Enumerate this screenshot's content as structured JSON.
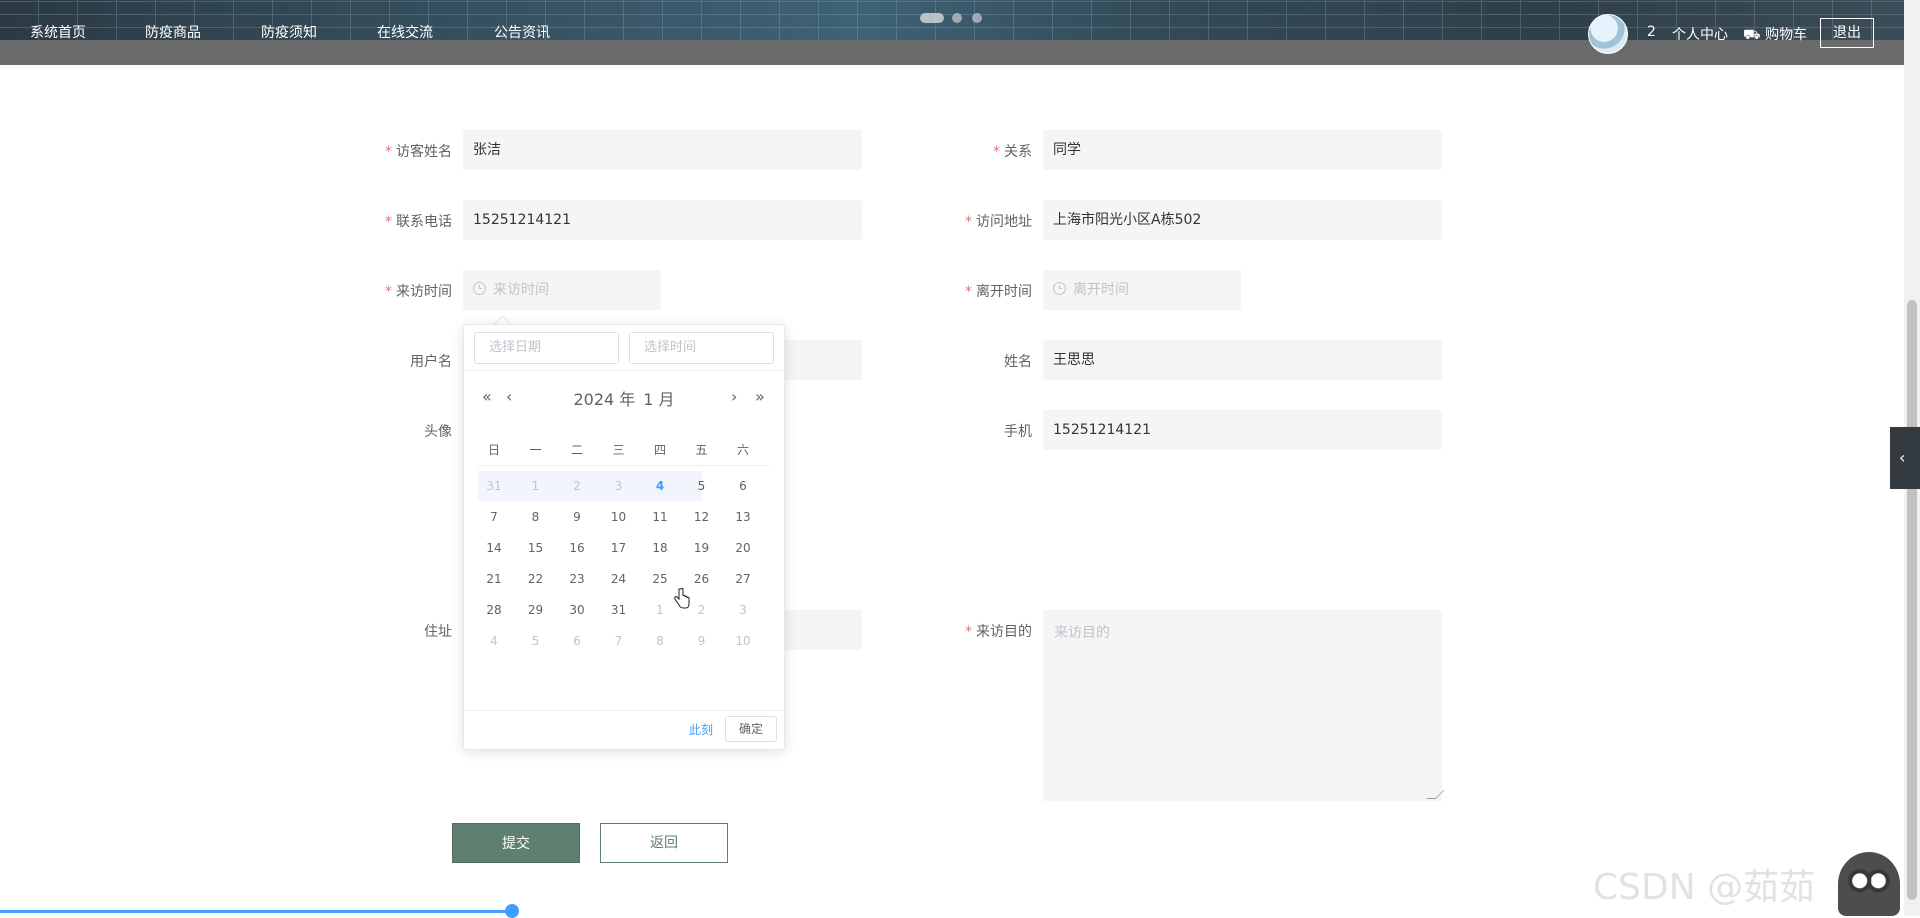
{
  "nav": {
    "items": [
      "系统首页",
      "防疫商品",
      "防疫须知",
      "在线交流",
      "公告资讯"
    ],
    "user_count": "2",
    "profile": "个人中心",
    "cart": "购物车",
    "logout": "退出"
  },
  "form": {
    "visitor_name": {
      "label": "访客姓名",
      "value": "张洁"
    },
    "relation": {
      "label": "关系",
      "value": "同学"
    },
    "phone": {
      "label": "联系电话",
      "value": "15251214121"
    },
    "address": {
      "label": "访问地址",
      "value": "上海市阳光小区A栋502"
    },
    "visit_time": {
      "label": "来访时间",
      "placeholder": "来访时间"
    },
    "leave_time": {
      "label": "离开时间",
      "placeholder": "离开时间"
    },
    "username": {
      "label": "用户名"
    },
    "name": {
      "label": "姓名",
      "value": "王思思"
    },
    "avatar": {
      "label": "头像"
    },
    "mobile": {
      "label": "手机",
      "value": "15251214121"
    },
    "residence": {
      "label": "住址"
    },
    "purpose": {
      "label": "来访目的",
      "placeholder": "来访目的"
    },
    "submit": "提交",
    "back": "返回"
  },
  "datepicker": {
    "date_placeholder": "选择日期",
    "time_placeholder": "选择时间",
    "year": "2024 年",
    "month": "1 月",
    "weekdays": [
      "日",
      "一",
      "二",
      "三",
      "四",
      "五",
      "六"
    ],
    "weeks": [
      [
        "31",
        "1",
        "2",
        "3",
        "4",
        "5",
        "6"
      ],
      [
        "7",
        "8",
        "9",
        "10",
        "11",
        "12",
        "13"
      ],
      [
        "14",
        "15",
        "16",
        "17",
        "18",
        "19",
        "20"
      ],
      [
        "21",
        "22",
        "23",
        "24",
        "25",
        "26",
        "27"
      ],
      [
        "28",
        "29",
        "30",
        "31",
        "1",
        "2",
        "3"
      ],
      [
        "4",
        "5",
        "6",
        "7",
        "8",
        "9",
        "10"
      ]
    ],
    "now": "此刻",
    "confirm": "确定"
  },
  "watermark": "CSDN @茹茹",
  "colors": {
    "primary_button": "#5f7f71",
    "required": "#f56c6c",
    "today": "#409eff"
  }
}
